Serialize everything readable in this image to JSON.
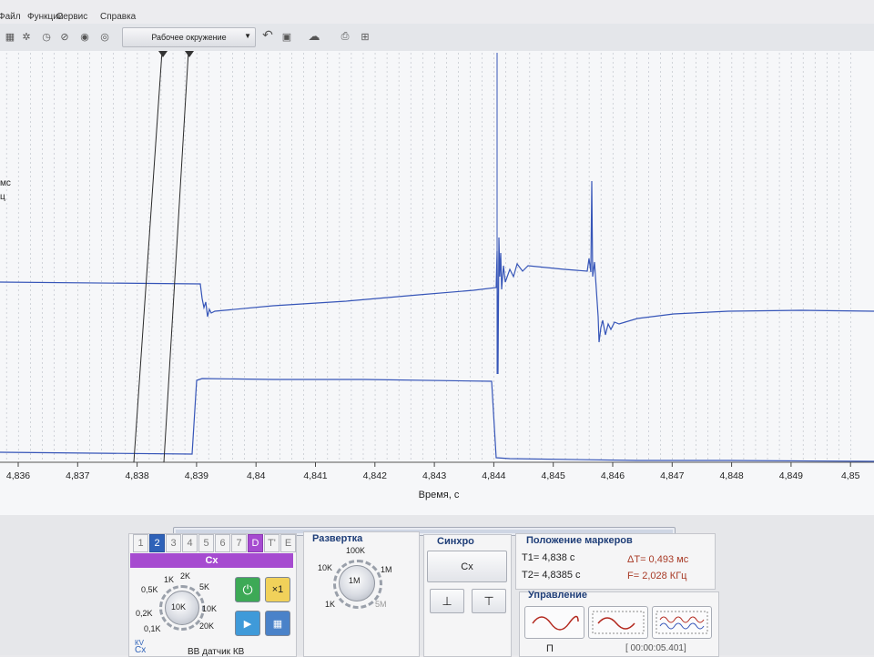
{
  "menu": {
    "items": [
      "Файл",
      "Функции",
      "Сервис",
      "Справка"
    ]
  },
  "toolbar": {
    "workspace_label": "Рабочее окружение",
    "icons": [
      "grid-icon",
      "gear-icon",
      "clock-icon",
      "info-icon",
      "help-icon",
      "undo-icon",
      "save-icon",
      "cloud-icon",
      "print-icon",
      "window-icon"
    ]
  },
  "scope": {
    "side_labels": [
      "мс",
      "ц"
    ],
    "x_axis_label": "Время, с",
    "tick_labels": [
      "4,836",
      "4,837",
      "4,838",
      "4,839",
      "4,84",
      "4,841",
      "4,842",
      "4,843",
      "4,844",
      "4,845",
      "4,846",
      "4,847",
      "4,848",
      "4,849",
      "4,85"
    ],
    "trace_color": "#3655b8",
    "marker_color": "#2a2a2a"
  },
  "channels": {
    "tabs": [
      "1",
      "2",
      "3",
      "4",
      "5",
      "6",
      "7",
      "D",
      "T'",
      "E"
    ],
    "active_tab": "2",
    "header": "Cx",
    "knob_labels": [
      "1K",
      "2K",
      "0,5K",
      "5K",
      "0,2K",
      "10K",
      "10K",
      "0,1K",
      "20K"
    ],
    "button_x1": "×1",
    "bottom_text": "ВВ датчик КВ",
    "kv_label": "КV",
    "cx_badge": "Cx"
  },
  "sweep": {
    "title": "Развертка",
    "center": "1М",
    "labels": [
      "100K",
      "10K",
      "1М",
      "1K",
      "5М"
    ]
  },
  "sync": {
    "title": "Синхро",
    "mode_button": "Сх"
  },
  "markers": {
    "title": "Положение маркеров",
    "t1": "T1= 4,838 с",
    "t2": "T2= 4,8385 с",
    "dt": "ΔT= 0,493 мс",
    "freq": "F= 2,028 КГц"
  },
  "control": {
    "title": "Управление",
    "bottom_button": "П",
    "time_readout": "[ 00:00:05.401]"
  }
}
